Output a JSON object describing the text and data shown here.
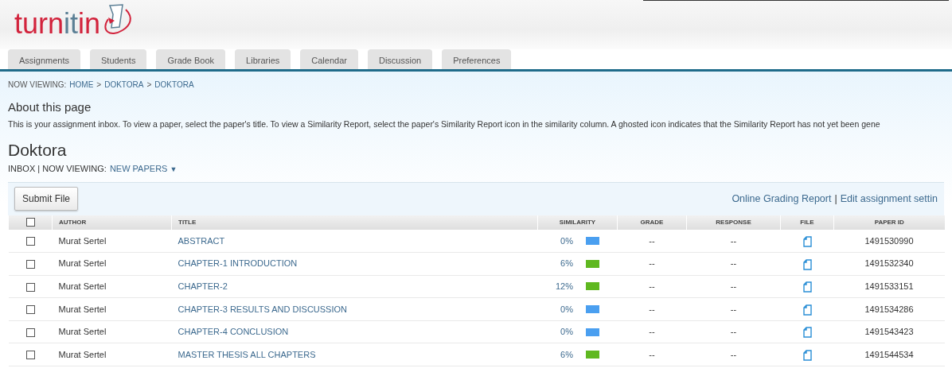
{
  "logo": [
    {
      "text": "turn",
      "color": "#d2233c"
    },
    {
      "text": "it",
      "color": "#5b7f95"
    },
    {
      "text": "in",
      "color": "#d2233c"
    }
  ],
  "tabs": [
    {
      "label": "Assignments",
      "selected": false
    },
    {
      "label": "Students",
      "selected": false
    },
    {
      "label": "Grade Book",
      "selected": false
    },
    {
      "label": "Libraries",
      "selected": false
    },
    {
      "label": "Calendar",
      "selected": false
    },
    {
      "label": "Discussion",
      "selected": false
    },
    {
      "label": "Preferences",
      "selected": false
    }
  ],
  "breadcrumb": {
    "prefix": "NOW VIEWING:",
    "items": [
      "HOME",
      "DOKTORA",
      "DOKTORA"
    ],
    "separator": ">"
  },
  "about": {
    "title": "About this page",
    "text": "This is your assignment inbox. To view a paper, select the paper's title. To view a Similarity Report, select the paper's Similarity Report icon in the similarity column. A ghosted icon indicates that the Similarity Report has not yet been gene"
  },
  "assignment": {
    "title": "Doktora",
    "inbox_label": "INBOX | NOW VIEWING:",
    "filter": "NEW PAPERS",
    "filter_caret": "▼"
  },
  "toolbar": {
    "button": "Submit File",
    "links": [
      "Online Grading Report",
      "Edit assignment settin"
    ],
    "separator": "|"
  },
  "table": {
    "select_all_checked": false,
    "columns": [
      "AUTHOR",
      "TITLE",
      "SIMILARITY",
      "GRADE",
      "RESPONSE",
      "FILE",
      "PAPER ID"
    ],
    "rows": [
      {
        "checked": false,
        "author": "Murat Sertel",
        "title": "ABSTRACT",
        "similarity": "0%",
        "color": "#4a9ff0",
        "grade": "--",
        "response": "--",
        "paper_id": "1491530990"
      },
      {
        "checked": false,
        "author": "Murat Sertel",
        "title": "CHAPTER-1 INTRODUCTION",
        "similarity": "6%",
        "color": "#5fb820",
        "grade": "--",
        "response": "--",
        "paper_id": "1491532340"
      },
      {
        "checked": false,
        "author": "Murat Sertel",
        "title": "CHAPTER-2",
        "similarity": "12%",
        "color": "#5fb820",
        "grade": "--",
        "response": "--",
        "paper_id": "1491533151"
      },
      {
        "checked": false,
        "author": "Murat Sertel",
        "title": "CHAPTER-3 RESULTS AND DISCUSSION",
        "similarity": "0%",
        "color": "#4a9ff0",
        "grade": "--",
        "response": "--",
        "paper_id": "1491534286"
      },
      {
        "checked": false,
        "author": "Murat Sertel",
        "title": "CHAPTER-4 CONCLUSION",
        "similarity": "0%",
        "color": "#4a9ff0",
        "grade": "--",
        "response": "--",
        "paper_id": "1491543423"
      },
      {
        "checked": false,
        "author": "Murat Sertel",
        "title": "MASTER THESIS ALL CHAPTERS",
        "similarity": "6%",
        "color": "#5fb820",
        "grade": "--",
        "response": "--",
        "paper_id": "1491544534"
      }
    ]
  }
}
